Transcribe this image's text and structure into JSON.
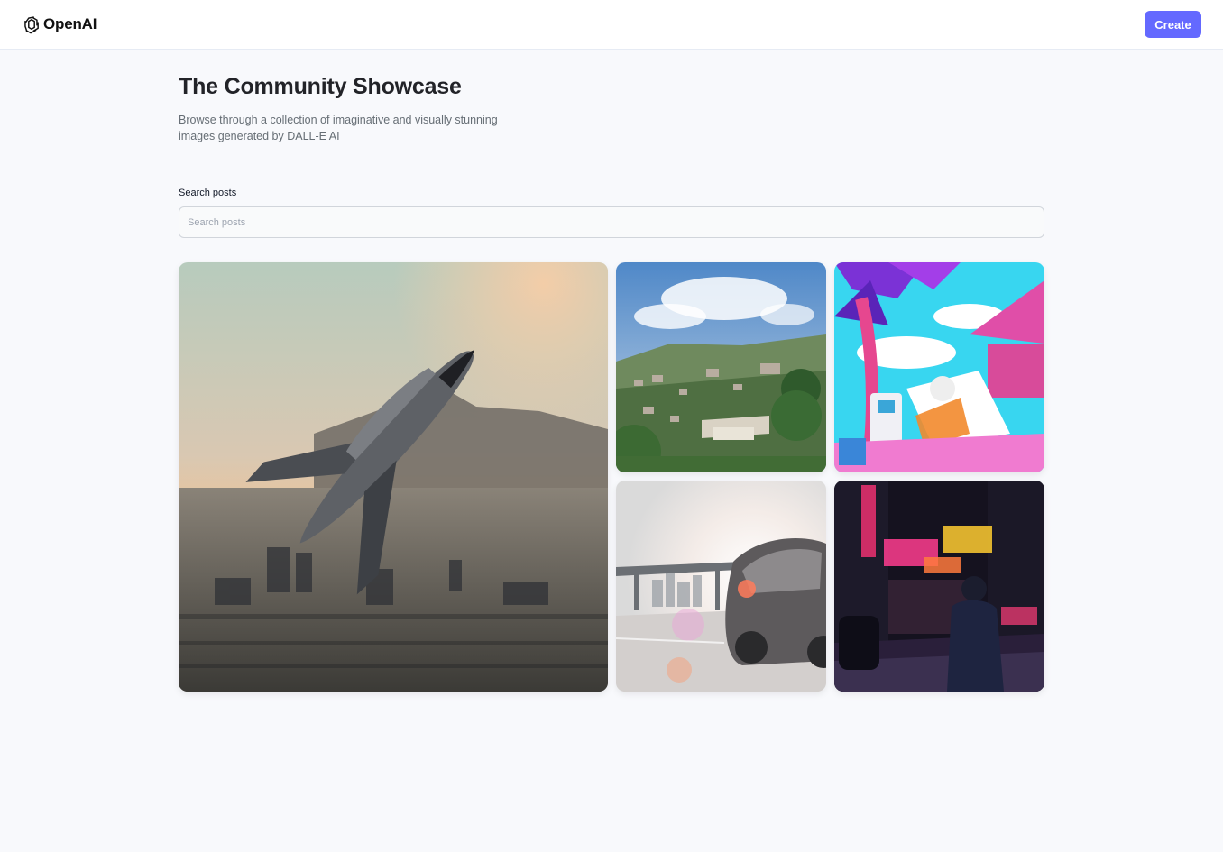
{
  "header": {
    "brand": "OpenAI",
    "create_label": "Create",
    "accent_color": "#6469ff"
  },
  "main": {
    "title": "The Community Showcase",
    "subtitle": "Browse through a collection of imaginative and visually stunning images generated by DALL-E AI",
    "search": {
      "label": "Search posts",
      "placeholder": "Search posts",
      "value": ""
    }
  },
  "posts": [
    {
      "subject": "space shuttle over city at sunset"
    },
    {
      "subject": "hillside town with trees"
    },
    {
      "subject": "astronaut lounging in neon tropical scene"
    },
    {
      "subject": "car on highway with sun flare"
    },
    {
      "subject": "man walking on neon-lit city street at night"
    }
  ]
}
